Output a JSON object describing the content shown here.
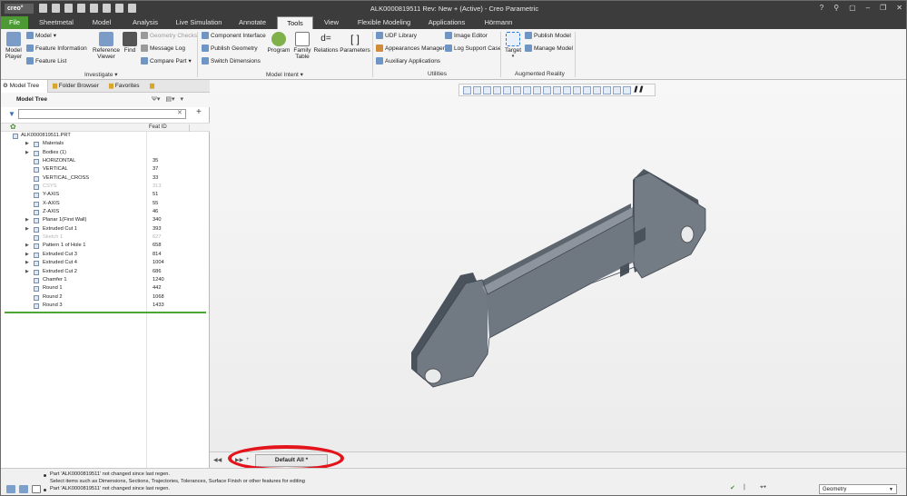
{
  "window": {
    "logo": "creo°",
    "title": "ALK0000819511 Rev: New + (Active) - Creo Parametric",
    "controls": [
      "?",
      "⚲",
      "▢",
      "–",
      "❐",
      "✕"
    ]
  },
  "tabs": [
    "File",
    "Sheetmetal",
    "Model",
    "Analysis",
    "Live Simulation",
    "Annotate",
    "Tools",
    "View",
    "Flexible Modeling",
    "Applications",
    "Hörmann"
  ],
  "ribbon": {
    "model": "Model",
    "feature_information": "Feature Information",
    "feature_list": "Feature List",
    "model_player": "Model\nPlayer",
    "reference_viewer": "Reference\nViewer",
    "find": "Find",
    "geometry_checks": "Geometry Checks",
    "message_log": "Message Log",
    "compare_part": "Compare Part",
    "investigate": "Investigate ▾",
    "component_interface": "Component Interface",
    "publish_geometry": "Publish Geometry",
    "switch_dimensions": "Switch Dimensions",
    "program": "Program",
    "family_table": "Family\nTable",
    "relations": "Relations",
    "parameters": "Parameters",
    "model_intent": "Model Intent ▾",
    "udf_library": "UDF Library",
    "appearances_manager": "Appearances Manager",
    "auxiliary_applications": "Auxiliary Applications",
    "image_editor": "Image Editor",
    "log_support_case": "Log Support Case",
    "utilities": "Utilities",
    "target": "Target",
    "publish_model": "Publish Model",
    "manage_model": "Manage Model",
    "augmented_reality": "Augmented Reality"
  },
  "navigator": {
    "tabs": [
      "Model Tree",
      "Folder Browser",
      "Favorites"
    ],
    "title": "Model Tree",
    "search_value": "",
    "col_feat_id": "Feat ID",
    "items": [
      {
        "label": "ALK0000819511.PRT",
        "id": "",
        "indent": 0,
        "arrow": "",
        "dim": false
      },
      {
        "label": "Materials",
        "id": "",
        "indent": 1,
        "arrow": "▶",
        "dim": false
      },
      {
        "label": "Bodies (1)",
        "id": "",
        "indent": 1,
        "arrow": "▶",
        "dim": false
      },
      {
        "label": "HORIZONTAL",
        "id": "35",
        "indent": 1,
        "arrow": "",
        "dim": false
      },
      {
        "label": "VERTICAL",
        "id": "37",
        "indent": 1,
        "arrow": "",
        "dim": false
      },
      {
        "label": "VERTICAL_CROSS",
        "id": "33",
        "indent": 1,
        "arrow": "",
        "dim": false
      },
      {
        "label": "CSYS",
        "id": "313",
        "indent": 1,
        "arrow": "",
        "dim": true
      },
      {
        "label": "Y-AXIS",
        "id": "51",
        "indent": 1,
        "arrow": "",
        "dim": false
      },
      {
        "label": "X-AXIS",
        "id": "55",
        "indent": 1,
        "arrow": "",
        "dim": false
      },
      {
        "label": "Z-AXIS",
        "id": "46",
        "indent": 1,
        "arrow": "",
        "dim": false
      },
      {
        "label": "Planar 1(First Wall)",
        "id": "340",
        "indent": 1,
        "arrow": "▶",
        "dim": false
      },
      {
        "label": "Extruded Cut 1",
        "id": "393",
        "indent": 1,
        "arrow": "▶",
        "dim": false
      },
      {
        "label": "Sketch 1",
        "id": "627",
        "indent": 1,
        "arrow": "",
        "dim": true
      },
      {
        "label": "Pattern 1 of Hole 1",
        "id": "658",
        "indent": 1,
        "arrow": "▶",
        "dim": false
      },
      {
        "label": "Extruded Cut 3",
        "id": "814",
        "indent": 1,
        "arrow": "▶",
        "dim": false
      },
      {
        "label": "Extruded Cut 4",
        "id": "1004",
        "indent": 1,
        "arrow": "▶",
        "dim": false
      },
      {
        "label": "Extruded Cut 2",
        "id": "686",
        "indent": 1,
        "arrow": "▶",
        "dim": false
      },
      {
        "label": "Chamfer 1",
        "id": "1240",
        "indent": 1,
        "arrow": "",
        "dim": false
      },
      {
        "label": "Round 1",
        "id": "442",
        "indent": 1,
        "arrow": "",
        "dim": false
      },
      {
        "label": "Round 2",
        "id": "1068",
        "indent": 1,
        "arrow": "",
        "dim": false
      },
      {
        "label": "Round 3",
        "id": "1433",
        "indent": 1,
        "arrow": "",
        "dim": false
      }
    ]
  },
  "sheet_tab": "Default All *",
  "status": {
    "messages": [
      "Part 'ALK0000819511' not changed since last regen.",
      "Select items such as Dimensions, Sections, Trajectories, Tolerances, Surface Finish or other features for editing",
      "Part 'ALK0000819511' not changed since last regen."
    ],
    "selection_filter": "Geometry"
  },
  "colors": {
    "titlebar": "#3c3c3c",
    "file_tab": "#4d9a35",
    "highlight": "#e3141b",
    "part": "#6f7884"
  }
}
